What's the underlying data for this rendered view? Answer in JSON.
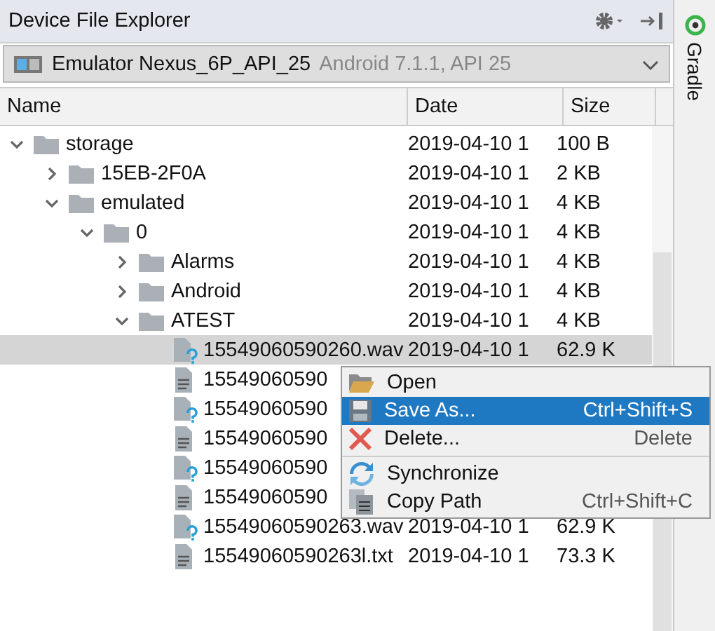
{
  "panel": {
    "title": "Device File Explorer"
  },
  "device": {
    "name": "Emulator Nexus_6P_API_25",
    "detail": "Android 7.1.1, API 25"
  },
  "columns": [
    "Name",
    "Date",
    "Size"
  ],
  "tree": [
    {
      "kind": "folder",
      "name": "storage",
      "date": "2019-04-10 1",
      "size": "100 B",
      "expanded": true,
      "selected": false,
      "children": [
        {
          "kind": "folder",
          "name": "15EB-2F0A",
          "date": "2019-04-10 1",
          "size": "2 KB",
          "expanded": false,
          "selected": false
        },
        {
          "kind": "folder",
          "name": "emulated",
          "date": "2019-04-10 1",
          "size": "4 KB",
          "expanded": true,
          "selected": false,
          "children": [
            {
              "kind": "folder",
              "name": "0",
              "date": "2019-04-10 1",
              "size": "4 KB",
              "expanded": true,
              "selected": false,
              "children": [
                {
                  "kind": "folder",
                  "name": "Alarms",
                  "date": "2019-04-10 1",
                  "size": "4 KB",
                  "expanded": false,
                  "selected": false
                },
                {
                  "kind": "folder",
                  "name": "Android",
                  "date": "2019-04-10 1",
                  "size": "4 KB",
                  "expanded": false,
                  "selected": false
                },
                {
                  "kind": "folder",
                  "name": "ATEST",
                  "date": "2019-04-10 1",
                  "size": "4 KB",
                  "expanded": true,
                  "selected": false,
                  "children": [
                    {
                      "kind": "unknown",
                      "name": "15549060590260.wav",
                      "date": "2019-04-10 1",
                      "size": "62.9 K",
                      "selected": true
                    },
                    {
                      "kind": "text",
                      "name": "15549060590",
                      "selected": false
                    },
                    {
                      "kind": "unknown",
                      "name": "15549060590",
                      "selected": false
                    },
                    {
                      "kind": "text",
                      "name": "15549060590",
                      "selected": false
                    },
                    {
                      "kind": "unknown",
                      "name": "15549060590",
                      "selected": false
                    },
                    {
                      "kind": "text",
                      "name": "15549060590",
                      "selected": false
                    },
                    {
                      "kind": "unknown",
                      "name": "15549060590263.wav",
                      "date": "2019-04-10 1",
                      "size": "62.9 K",
                      "selected": false
                    },
                    {
                      "kind": "text",
                      "name": "15549060590263l.txt",
                      "date": "2019-04-10 1",
                      "size": "73.3 K",
                      "selected": false
                    }
                  ]
                }
              ]
            }
          ]
        }
      ]
    }
  ],
  "context_menu": [
    {
      "kind": "open",
      "label": "Open",
      "selected": false
    },
    {
      "kind": "save",
      "label": "Save As...",
      "shortcut": "Ctrl+Shift+S",
      "selected": true
    },
    {
      "kind": "delete",
      "label": "Delete...",
      "shortcut": "Delete",
      "selected": false,
      "separator_after": true
    },
    {
      "kind": "sync",
      "label": "Synchronize",
      "selected": false
    },
    {
      "kind": "copy",
      "label": "Copy Path",
      "shortcut": "Ctrl+Shift+C",
      "selected": false
    }
  ],
  "side_strip": {
    "label": "Gradle"
  }
}
